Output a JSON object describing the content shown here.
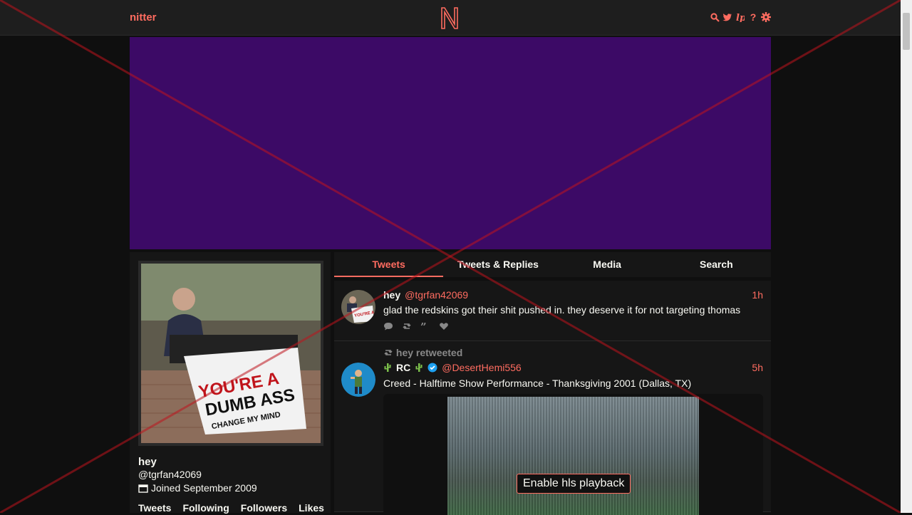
{
  "nav": {
    "brand": "nitter",
    "icons": [
      "search-icon",
      "twitter-icon",
      "rss-icon",
      "help-icon",
      "settings-icon"
    ]
  },
  "colors": {
    "accent": "#ff6c60",
    "banner": "#3c0a66",
    "background": "#0f0f0f",
    "panel": "#161616"
  },
  "profile": {
    "name": "hey",
    "handle": "@tgrfan42069",
    "joined": "Joined September 2009",
    "stats": [
      "Tweets",
      "Following",
      "Followers",
      "Likes"
    ],
    "avatar_sign": {
      "line1": "YOU'RE A",
      "line2": "DUMB ASS",
      "line3": "CHANGE MY MIND"
    }
  },
  "tabs": [
    {
      "label": "Tweets",
      "active": true
    },
    {
      "label": "Tweets & Replies",
      "active": false
    },
    {
      "label": "Media",
      "active": false
    },
    {
      "label": "Search",
      "active": false
    }
  ],
  "tweets": [
    {
      "fullname": "hey",
      "username": "@tgrfan42069",
      "time": "1h",
      "content": "glad the redskins got their shit pushed in. they deserve it for not targeting thomas"
    },
    {
      "retweet_header": "hey retweeted",
      "fullname": "RC",
      "username": "@DesertHemi556",
      "time": "5h",
      "content": "Creed - Halftime Show Performance - Thanksgiving 2001 (Dallas, TX)",
      "video_button": "Enable hls playback"
    }
  ]
}
